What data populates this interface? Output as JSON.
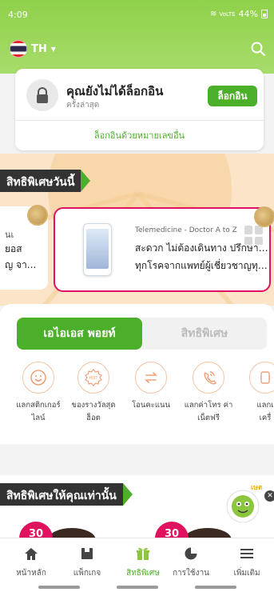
{
  "status_bar": {
    "time": "4:09",
    "signal": "VoLTE",
    "battery": "44%"
  },
  "header": {
    "language": "TH"
  },
  "login_card": {
    "title": "คุณยังไม่ได้ล็อกอิน",
    "subtitle": "ครั้งล่าสุด",
    "login_label": "ล็อกอิน",
    "mobile_login_label": "ล็อกอินด้วยหมายเลขอื่น"
  },
  "today_privileges": {
    "heading": "สิทธิพิเศษวันนี้",
    "left_card": {
      "line1": "นเ",
      "line2": "ยอส",
      "line3": "ญ จา..."
    },
    "main_card": {
      "category": "Telemedicine - Doctor A to Z",
      "line1": "สะดวก ไม่ต้องเดินทาง ปรึกษาได้",
      "line2": "ทุกโรคจากแพทย์ผู้เชี่ยวชาญทุก..."
    }
  },
  "points_tabs": {
    "active": "เอไอเอส พอยท์",
    "inactive": "สิทธิพิเศษ"
  },
  "shortcuts": [
    {
      "icon": "smile-icon",
      "label1": "แลกสติกเกอร์",
      "label2": "ไลน์"
    },
    {
      "icon": "hot-icon",
      "label1": "ของรางวัลสุด",
      "label2": "ฮ็อต"
    },
    {
      "icon": "transfer-icon",
      "label1": "โอนคะแนน",
      "label2": ""
    },
    {
      "icon": "call-icon",
      "label1": "แลกค่าโทร ค่า",
      "label2": "เน็ตฟรี"
    },
    {
      "icon": "partial-icon",
      "label1": "แลกเ",
      "label2": "เครื่"
    }
  ],
  "exclusive": {
    "heading": "สิทธิพิเศษให้คุณเท่านั้น",
    "badge1": "30",
    "badge2": "30",
    "mascot_tag": "เษต"
  },
  "bottom_nav": [
    {
      "icon": "home-icon",
      "label": "หน้าหลัก",
      "active": false
    },
    {
      "icon": "package-icon",
      "label": "แพ็กเกจ",
      "active": false
    },
    {
      "icon": "gift-icon",
      "label": "สิทธิพิเศษ",
      "active": true
    },
    {
      "icon": "usage-icon",
      "label": "การใช้งาน",
      "active": false
    },
    {
      "icon": "menu-icon",
      "label": "เพิ่มเติม",
      "active": false
    }
  ],
  "colors": {
    "accent": "#4caf2a",
    "highlight": "#e0115f",
    "header": "#8fd14a"
  }
}
